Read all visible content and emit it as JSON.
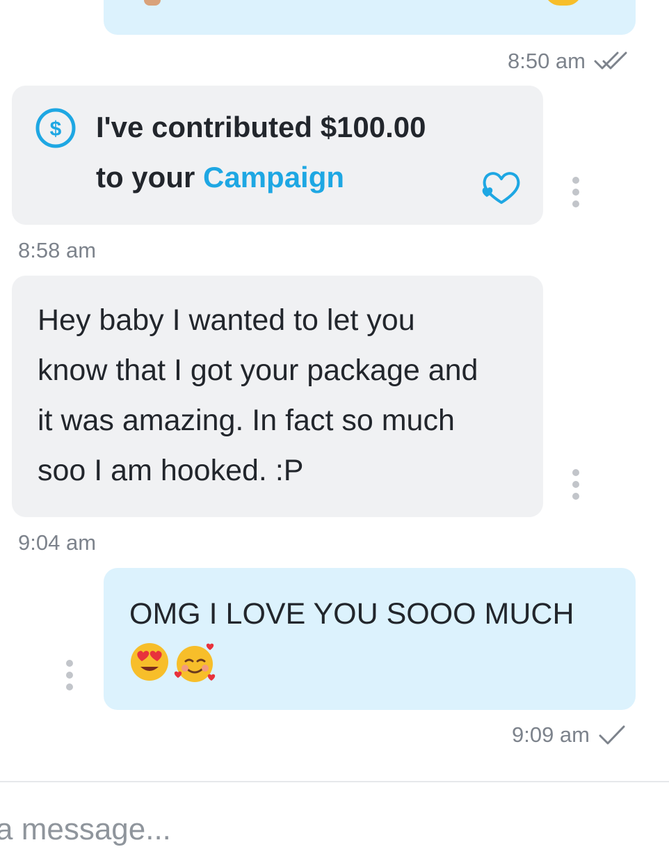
{
  "messages": [
    {
      "direction": "outgoing",
      "text": "",
      "time": "8:50 am",
      "status": "double-check-icon"
    },
    {
      "direction": "incoming",
      "type": "tip",
      "line1": "I've contributed $100.00",
      "line2_prefix": "to your ",
      "link": "Campaign",
      "icon": "dollar-circle-icon",
      "reaction_icon": "heart-reaction-icon",
      "time": "8:58 am"
    },
    {
      "direction": "incoming",
      "text": "Hey baby I wanted to let you know that I got your package and it was amazing. In fact so much soo I am hooked. :P",
      "time": "9:04 am"
    },
    {
      "direction": "outgoing",
      "text": "OMG I LOVE YOU SOOO MUCH",
      "emojis": "😍🥰",
      "time": "9:09 am",
      "status": "check-icon"
    }
  ],
  "composer": {
    "placeholder": "a message..."
  },
  "colors": {
    "outgoing_bubble": "#dcf2fd",
    "incoming_bubble": "#f0f1f3",
    "accent": "#1ea7e3",
    "timestamp": "#7d838c"
  }
}
